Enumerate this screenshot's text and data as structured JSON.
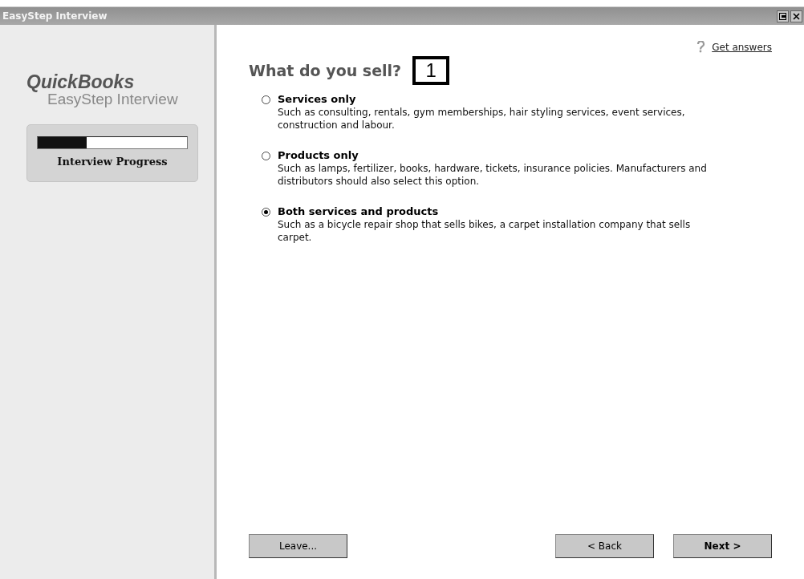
{
  "window": {
    "title": "EasyStep Interview",
    "controls": [
      {
        "kind": "restore"
      },
      {
        "kind": "close"
      }
    ]
  },
  "sidebar": {
    "brand": "QuickBooks",
    "subtitle": "EasyStep Interview",
    "progress": {
      "level": 0.33,
      "label": "Interview Progress"
    }
  },
  "help_link": "Get answers",
  "question": "What do you sell?",
  "callout": "1",
  "options": [
    {
      "label": "Services only",
      "description": "Such as consulting, rentals, gym memberships, hair styling services, event services, construction and labour.",
      "selected": false
    },
    {
      "label": "Products only",
      "description": "Such as lamps, fertilizer, books, hardware, tickets, insurance policies. Manufacturers and distributors should also select this option.",
      "selected": false
    },
    {
      "label": "Both services and products",
      "description": "Such as a bicycle repair shop that sells bikes, a carpet installation company that sells carpet.",
      "selected": true
    }
  ],
  "buttons": [
    {
      "label": "Leave...",
      "kind": "leave"
    },
    {
      "label": "< Back",
      "kind": "back"
    },
    {
      "label": "Next >",
      "kind": "next"
    }
  ]
}
